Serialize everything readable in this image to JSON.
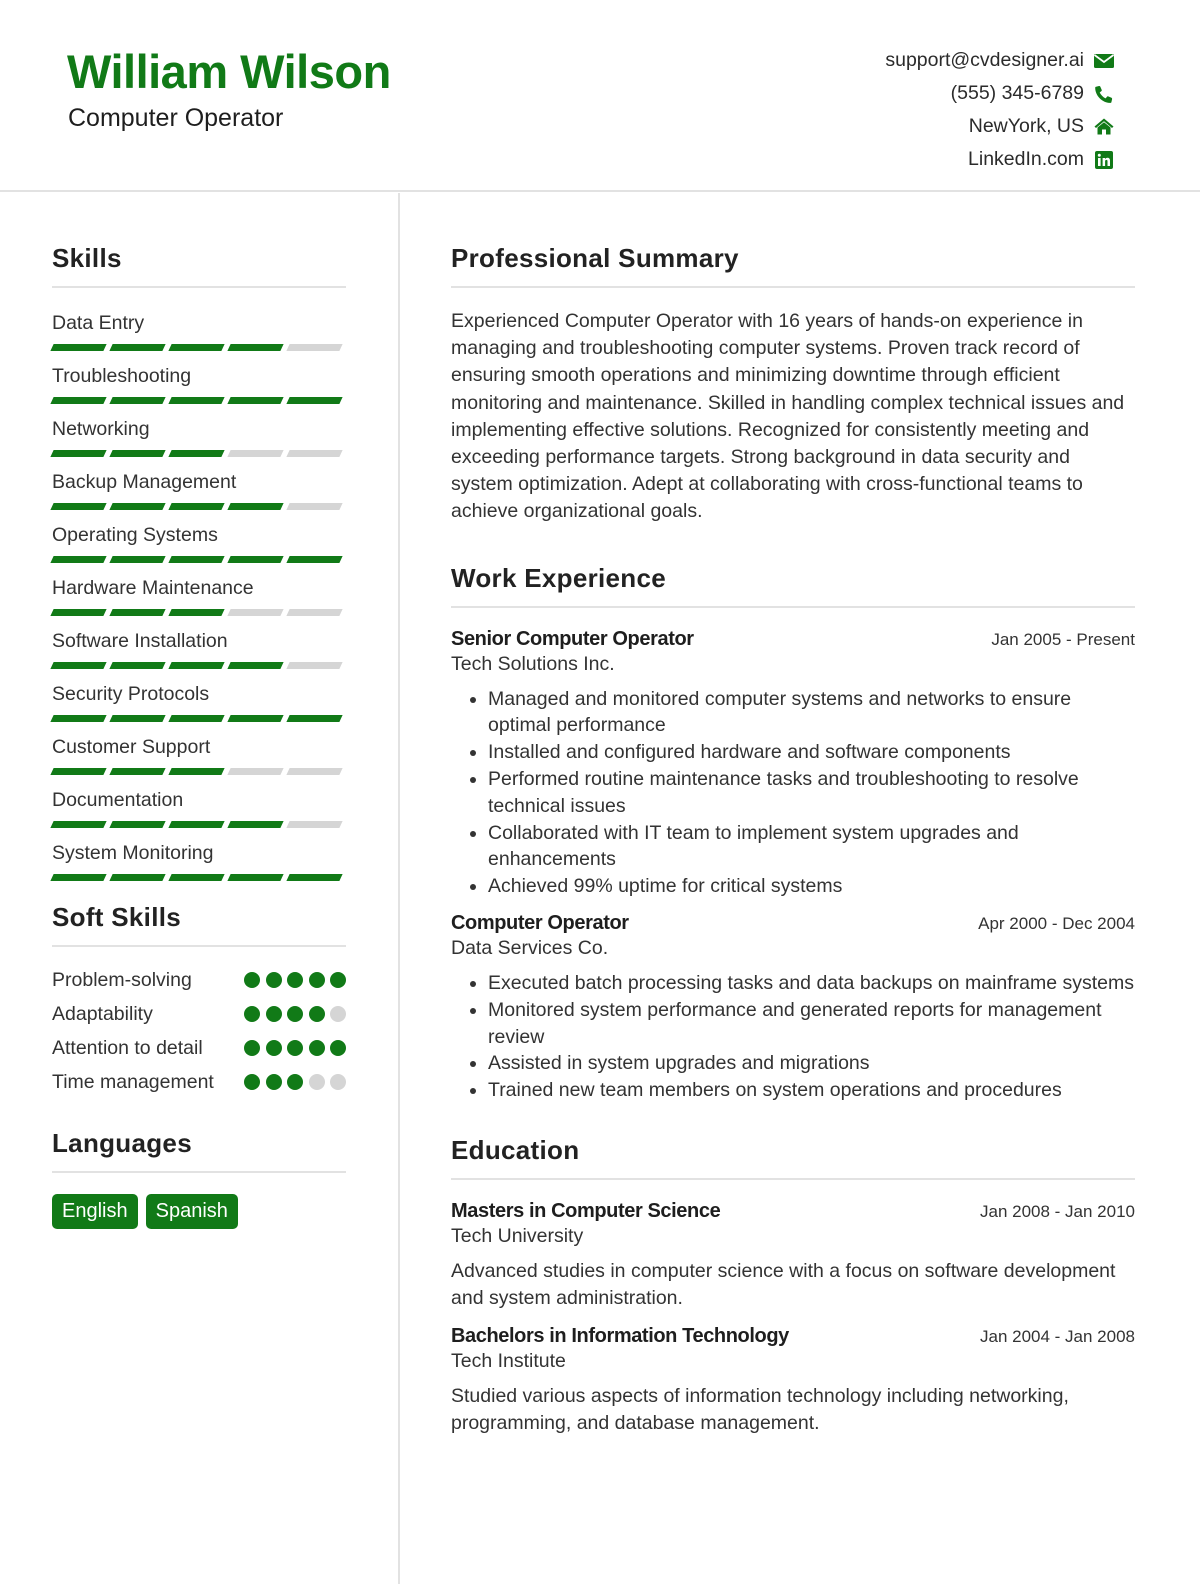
{
  "header": {
    "name": "William Wilson",
    "title": "Computer Operator",
    "accent_color": "#117a17",
    "contact": [
      {
        "text": "support@cvdesigner.ai",
        "icon": "envelope-icon"
      },
      {
        "text": "(555) 345-6789",
        "icon": "phone-icon"
      },
      {
        "text": "NewYork, US",
        "icon": "home-icon"
      },
      {
        "text": "LinkedIn.com",
        "icon": "linkedin-icon"
      }
    ]
  },
  "skills": {
    "heading": "Skills",
    "max": 5,
    "items": [
      {
        "name": "Data Entry",
        "level": 4
      },
      {
        "name": "Troubleshooting",
        "level": 5
      },
      {
        "name": "Networking",
        "level": 3
      },
      {
        "name": "Backup Management",
        "level": 4
      },
      {
        "name": "Operating Systems",
        "level": 5
      },
      {
        "name": "Hardware Maintenance",
        "level": 3
      },
      {
        "name": "Software Installation",
        "level": 4
      },
      {
        "name": "Security Protocols",
        "level": 5
      },
      {
        "name": "Customer Support",
        "level": 3
      },
      {
        "name": "Documentation",
        "level": 4
      },
      {
        "name": "System Monitoring",
        "level": 5
      }
    ]
  },
  "soft_skills": {
    "heading": "Soft Skills",
    "max": 5,
    "items": [
      {
        "name": "Problem-solving",
        "level": 5
      },
      {
        "name": "Adaptability",
        "level": 4
      },
      {
        "name": "Attention to detail",
        "level": 5
      },
      {
        "name": "Time management",
        "level": 3
      }
    ]
  },
  "languages": {
    "heading": "Languages",
    "items": [
      "English",
      "Spanish"
    ]
  },
  "summary": {
    "heading": "Professional Summary",
    "text": "Experienced Computer Operator with 16 years of hands-on experience in managing and troubleshooting computer systems. Proven track record of ensuring smooth operations and minimizing downtime through efficient monitoring and maintenance. Skilled in handling complex technical issues and implementing effective solutions. Recognized for consistently meeting and exceeding performance targets. Strong background in data security and system optimization. Adept at collaborating with cross-functional teams to achieve organizational goals."
  },
  "experience": {
    "heading": "Work Experience",
    "items": [
      {
        "title": "Senior Computer Operator",
        "company": "Tech Solutions Inc.",
        "date": "Jan 2005 - Present",
        "bullets": [
          "Managed and monitored computer systems and networks to ensure optimal performance",
          "Installed and configured hardware and software components",
          "Performed routine maintenance tasks and troubleshooting to resolve technical issues",
          "Collaborated with IT team to implement system upgrades and enhancements",
          "Achieved 99% uptime for critical systems"
        ]
      },
      {
        "title": "Computer Operator",
        "company": "Data Services Co.",
        "date": "Apr 2000 - Dec 2004",
        "bullets": [
          "Executed batch processing tasks and data backups on mainframe systems",
          "Monitored system performance and generated reports for management review",
          "Assisted in system upgrades and migrations",
          "Trained new team members on system operations and procedures"
        ]
      }
    ]
  },
  "education": {
    "heading": "Education",
    "items": [
      {
        "degree": "Masters in Computer Science",
        "school": "Tech University",
        "date": "Jan 2008 - Jan 2010",
        "description": "Advanced studies in computer science with a focus on software development and system administration."
      },
      {
        "degree": "Bachelors in Information Technology",
        "school": "Tech Institute",
        "date": "Jan 2004 - Jan 2008",
        "description": "Studied various aspects of information technology including networking, programming, and database management."
      }
    ]
  }
}
